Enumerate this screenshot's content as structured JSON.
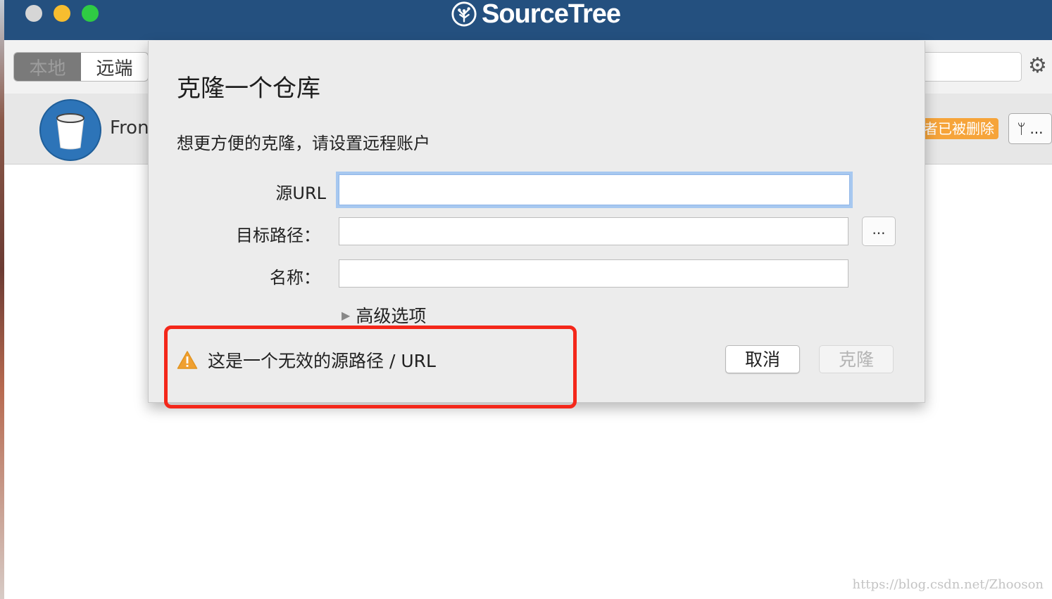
{
  "window": {
    "app_name": "SourceTree"
  },
  "toolbar": {
    "segment_local": "本地",
    "segment_remote": "远端"
  },
  "repo": {
    "name": "Fron",
    "deleted_badge": "者已被删除",
    "branch_more": "..."
  },
  "dialog": {
    "title": "克隆一个仓库",
    "subtitle": "想更方便的克隆，请设置远程账户",
    "source_url_label": "源URL",
    "destination_label": "目标路径：",
    "name_label": "名称：",
    "source_url_value": "",
    "destination_value": "",
    "name_value": "",
    "browse_label": "...",
    "advanced_options": "高级选项",
    "warning_text": "这是一个无效的源路径 / URL",
    "cancel_button": "取消",
    "clone_button": "克隆"
  },
  "watermark": "https://blog.csdn.net/Zhooson",
  "colors": {
    "titlebar": "#24507f",
    "warning_highlight": "#f4271a",
    "warning_icon": "#f0a030",
    "badge": "#f6a43a",
    "repo_icon": "#2d74b8"
  },
  "icons": {
    "brand": "sourcetree-logo-icon",
    "settings": "gear-icon",
    "repo": "bucket-icon",
    "branch": "branch-icon",
    "disclosure": "triangle-right-icon",
    "warning": "warning-triangle-icon"
  }
}
